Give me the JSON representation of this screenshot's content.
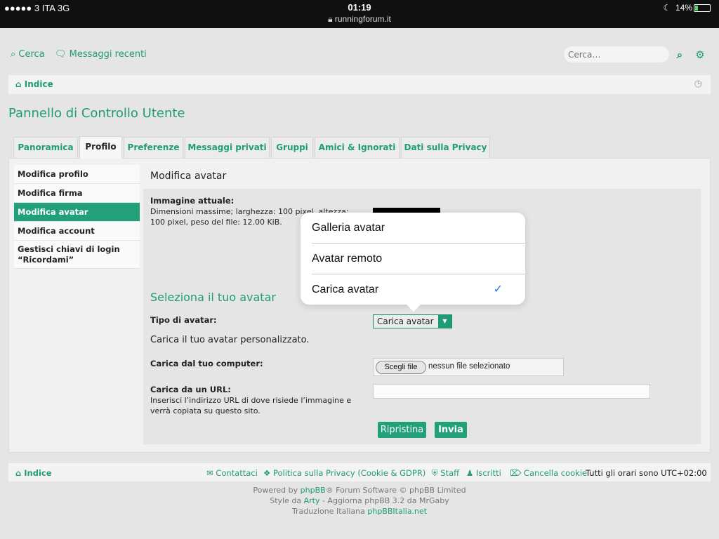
{
  "status_bar": {
    "carrier": "●●●●● 3 ITA  3G",
    "time": "01:19",
    "url": "runningforum.it",
    "battery": "14%"
  },
  "header": {
    "search_link": "Cerca",
    "recent_messages_link": "Messaggi recenti",
    "search_placeholder": "Cerca…"
  },
  "navbar": {
    "home": "Indice"
  },
  "page_title": "Pannello di Controllo Utente",
  "tabs": [
    {
      "label": "Panoramica",
      "active": false
    },
    {
      "label": "Profilo",
      "active": true
    },
    {
      "label": "Preferenze",
      "active": false
    },
    {
      "label": "Messaggi privati",
      "active": false
    },
    {
      "label": "Gruppi",
      "active": false
    },
    {
      "label": "Amici & Ignorati",
      "active": false
    },
    {
      "label": "Dati sulla Privacy",
      "active": false
    }
  ],
  "sidebar": [
    {
      "label": "Modifica profilo",
      "active": false
    },
    {
      "label": "Modifica firma",
      "active": false
    },
    {
      "label": "Modifica avatar",
      "active": true
    },
    {
      "label": "Modifica account",
      "active": false
    },
    {
      "label": "Gestisci chiavi di login “Ricordami”",
      "active": false
    }
  ],
  "content": {
    "section_title": "Modifica avatar",
    "current_image_label": "Immagine attuale:",
    "current_image_desc": "Dimensioni massime; larghezza: 100 pixel, altezza: 100 pixel, peso del file: 12.00 KiB.",
    "select_title": "Seleziona il tuo avatar",
    "avatar_type_label": "Tipo di avatar:",
    "avatar_type_value": "Carica avatar",
    "upload_desc": "Carica il tuo avatar personalizzato.",
    "upload_computer_label": "Carica dal tuo computer:",
    "file_button": "Scegli file",
    "file_status": "nessun file selezionato",
    "upload_url_label": "Carica da un URL:",
    "upload_url_desc": "Inserisci l’indirizzo URL di dove risiede l’immagine e verrà copiata su questo sito.",
    "reset_button": "Ripristina",
    "submit_button": "Invia"
  },
  "popover": {
    "options": [
      "Galleria avatar",
      "Avatar remoto",
      "Carica avatar"
    ],
    "selected": "Carica avatar"
  },
  "footer": {
    "home": "Indice",
    "contact": "Contattaci",
    "privacy": "Politica sulla Privacy (Cookie & GDPR)",
    "staff": "Staff",
    "members": "Iscritti",
    "delete_cookies": "Cancella cookie",
    "timezone": "Tutti gli orari sono UTC+02:00",
    "credit_powered_prefix": "Powered by ",
    "credit_phpbb": "phpBB",
    "credit_powered_suffix": "® Forum Software © phpBB Limited",
    "credit_style_prefix": "Style da ",
    "credit_arty": "Arty",
    "credit_style_suffix": " - Aggiorna phpBB 3.2 da MrGaby",
    "credit_translation_prefix": "Traduzione Italiana ",
    "credit_phpbbitalia": "phpBBItalia.net"
  },
  "colors": {
    "accent": "#1f9c77",
    "ios_check": "#1a7fe6"
  },
  "icons": [
    "search-icon",
    "chat-icon",
    "home-icon",
    "gear-icon",
    "clock-icon",
    "envelope-icon",
    "cubes-icon",
    "shield-icon",
    "users-icon",
    "trash-icon",
    "checkmark-icon",
    "dropdown-arrow-icon"
  ]
}
